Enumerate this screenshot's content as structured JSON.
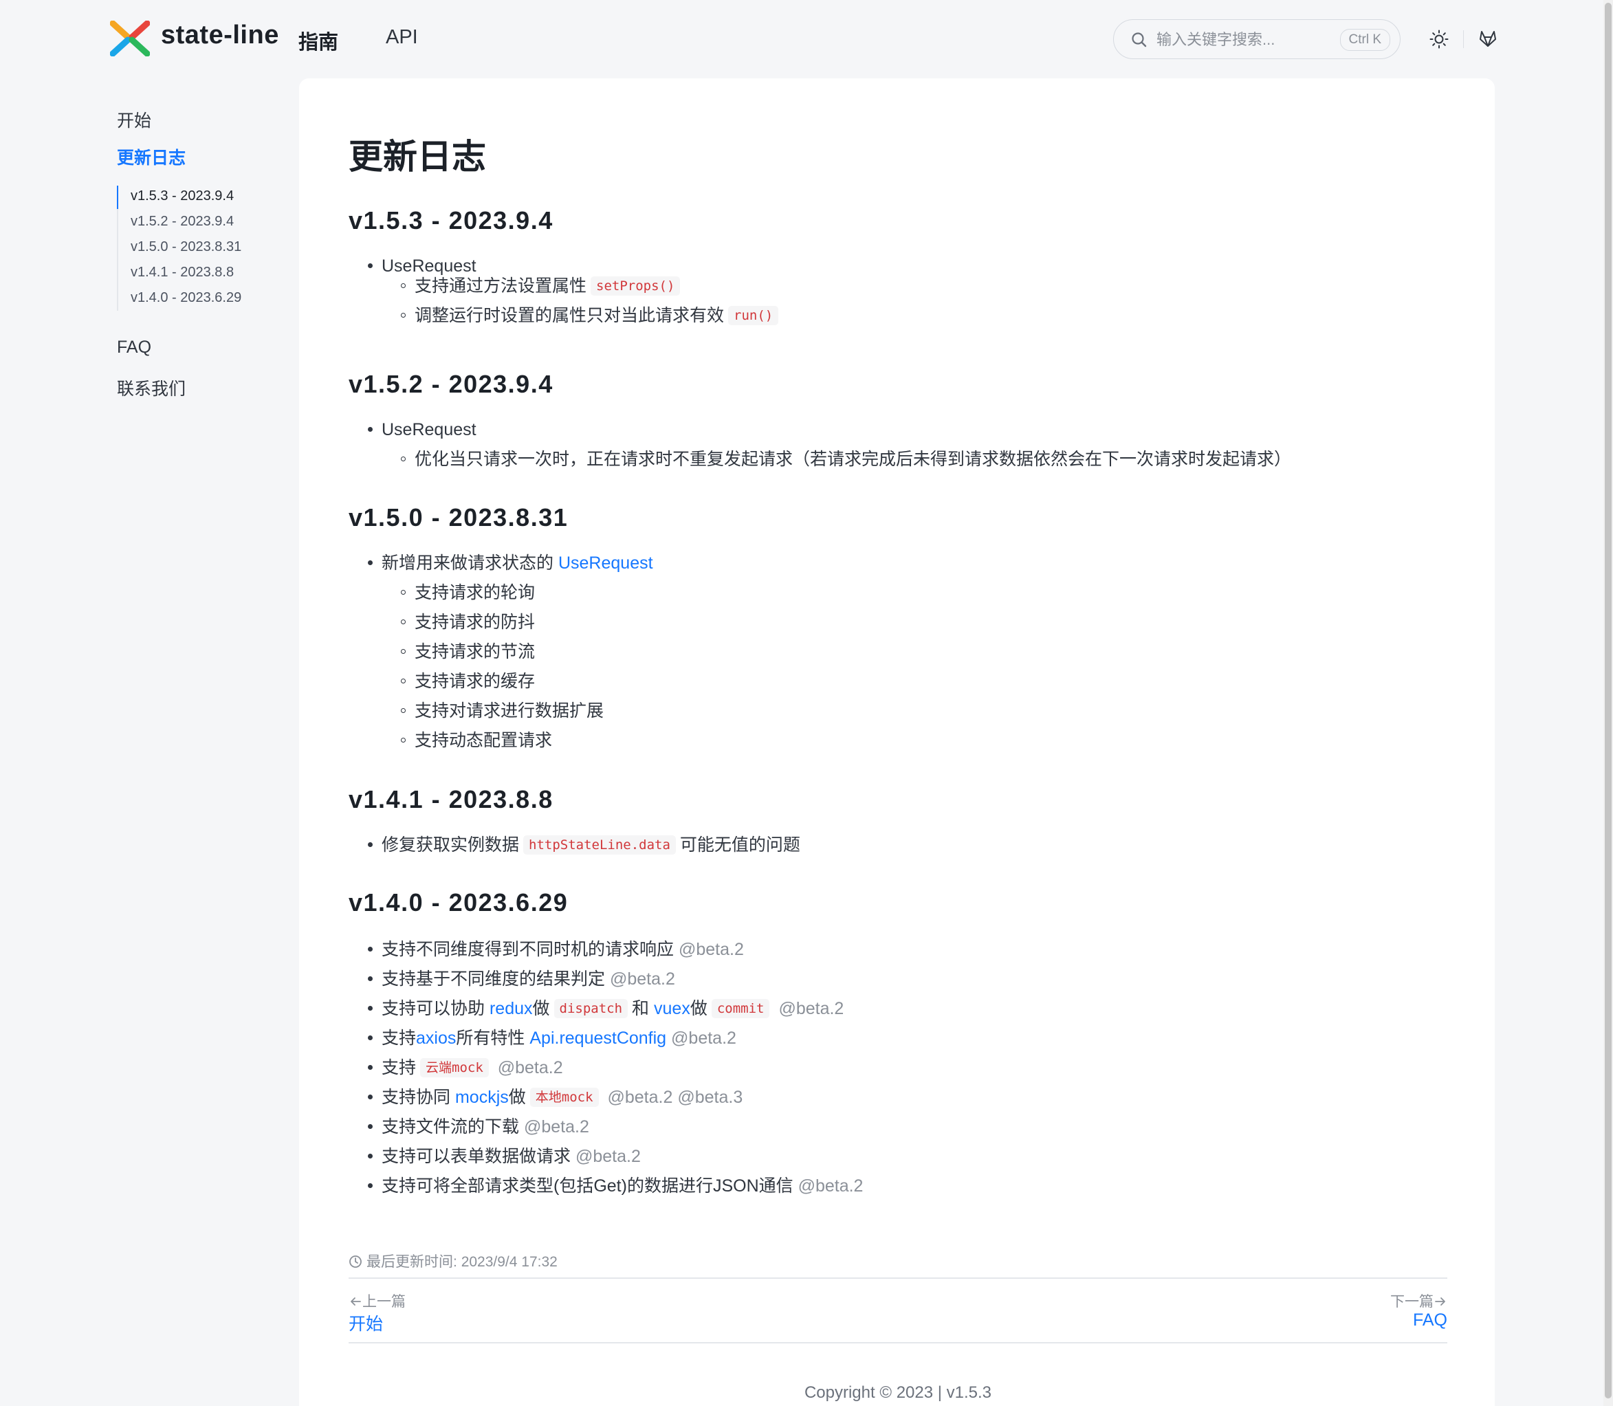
{
  "header": {
    "brand": "state-line",
    "nav": {
      "guide": "指南",
      "api": "API"
    },
    "search": {
      "placeholder": "输入关键字搜索...",
      "shortcut": "Ctrl K"
    },
    "icons": [
      "state-line-logo-icon",
      "search-icon",
      "sun-icon",
      "gitlab-icon"
    ]
  },
  "sidebar": {
    "start": "开始",
    "changelog": "更新日志",
    "toc": [
      "v1.5.3 - 2023.9.4",
      "v1.5.2 - 2023.9.4",
      "v1.5.0 - 2023.8.31",
      "v1.4.1 - 2023.8.8",
      "v1.4.0 - 2023.6.29"
    ],
    "faq": "FAQ",
    "contact": "联系我们"
  },
  "colors": {
    "accent": "#1677ff",
    "code_text": "#d1373a",
    "code_bg": "#f5f5f6",
    "muted": "#8b9098"
  },
  "content": {
    "title": "更新日志",
    "v153": {
      "heading": "v1.5.3 - 2023.9.4",
      "item": "UseRequest",
      "sub1_text": "支持通过方法设置属性",
      "sub1_code": "setProps()",
      "sub2_text": "调整运行时设置的属性只对当此请求有效",
      "sub2_code": "run()"
    },
    "v152": {
      "heading": "v1.5.2 - 2023.9.4",
      "item": "UseRequest",
      "sub1": "优化当只请求一次时，正在请求时不重复发起请求（若请求完成后未得到请求数据依然会在下一次请求时发起请求）"
    },
    "v150": {
      "heading": "v1.5.0 - 2023.8.31",
      "item_text": "新增用来做请求状态的",
      "item_link": "UseRequest",
      "subs": [
        "支持请求的轮询",
        "支持请求的防抖",
        "支持请求的节流",
        "支持请求的缓存",
        "支持对请求进行数据扩展",
        "支持动态配置请求"
      ]
    },
    "v141": {
      "heading": "v1.4.1 - 2023.8.8",
      "item_pre": "修复获取实例数据",
      "item_code": "httpStateLine.data",
      "item_post": "可能无值的问题"
    },
    "v140": {
      "heading": "v1.4.0 - 2023.6.29",
      "i1": "支持不同维度得到不同时机的请求响应",
      "i2": "支持基于不同维度的结果判定",
      "i3_pre": "支持可以协助",
      "i3_link1": "redux",
      "i3_mid1": "做",
      "i3_code1": "dispatch",
      "i3_mid2": "和",
      "i3_link2": "vuex",
      "i3_mid3": "做",
      "i3_code2": "commit",
      "i4_pre": "支持",
      "i4_link1": "axios",
      "i4_mid": "所有特性",
      "i4_link2": "Api.requestConfig",
      "i5_pre": "支持",
      "i5_code": "云端mock",
      "i6_pre": "支持协同",
      "i6_link": "mockjs",
      "i6_mid": "做",
      "i6_code": "本地mock",
      "i7": "支持文件流的下载",
      "i8": "支持可以表单数据做请求",
      "i9": "支持可将全部请求类型(包括Get)的数据进行JSON通信",
      "beta2": "@beta.2",
      "beta2_beta3": "@beta.2 @beta.3"
    }
  },
  "footer": {
    "last_updated_label": "最后更新时间:",
    "last_updated_value": "2023/9/4 17:32",
    "prev_label": "上一篇",
    "prev_link": "开始",
    "next_label": "下一篇",
    "next_link": "FAQ",
    "copyright": "Copyright © 2023 | v1.5.3"
  }
}
